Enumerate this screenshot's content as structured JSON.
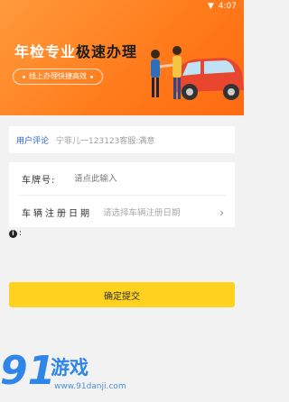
{
  "status": {
    "time": "4:07",
    "wifi_icon": "wifi-icon"
  },
  "hero": {
    "title_part1": "年检专业",
    "title_part2": "极速办理",
    "subtitle": "线上办理快捷高效"
  },
  "review": {
    "label": "用户评论",
    "text": "宁菲儿一123123客服:满意"
  },
  "form": {
    "plate_label": "车牌号:",
    "plate_placeholder": "请点此输入",
    "date_label": "车辆注册日期",
    "date_placeholder": "请选择车辆注册日期"
  },
  "info": {
    "text": ":"
  },
  "submit_label": "确定提交",
  "watermark": {
    "num": "91",
    "name": "游戏",
    "url": "www.91danji.com"
  },
  "colors": {
    "accent": "#ff7a1a",
    "button": "#ffd21f",
    "link": "#2a63d6"
  }
}
